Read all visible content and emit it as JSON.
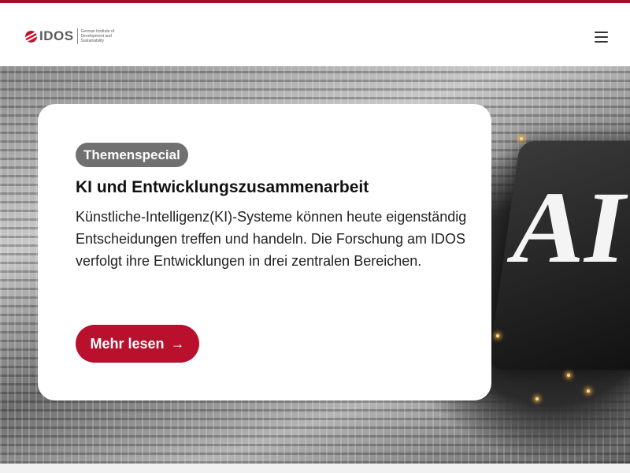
{
  "header": {
    "logo_text": "IDOS",
    "logo_subtitle": "German Institute of Development and Sustainability",
    "menu_icon": "hamburger-menu-icon"
  },
  "hero": {
    "image_description": "circuit board with AI chip",
    "chip_label": "AI"
  },
  "card": {
    "badge": "Themenspecial",
    "title": "KI und Entwicklungszusammenarbeit",
    "text": "Künstliche-Intelligenz(KI)-Systeme können heute eigenständig Entscheidungen treffen und handeln. Die Forschung am IDOS verfolgt ihre Entwicklungen in drei zentralen Bereichen.",
    "cta_label": "Mehr lesen",
    "cta_icon": "arrow-right-icon"
  },
  "colors": {
    "brand_red": "#b8102d",
    "top_bar": "#a3102b",
    "badge_gray": "#707070"
  }
}
